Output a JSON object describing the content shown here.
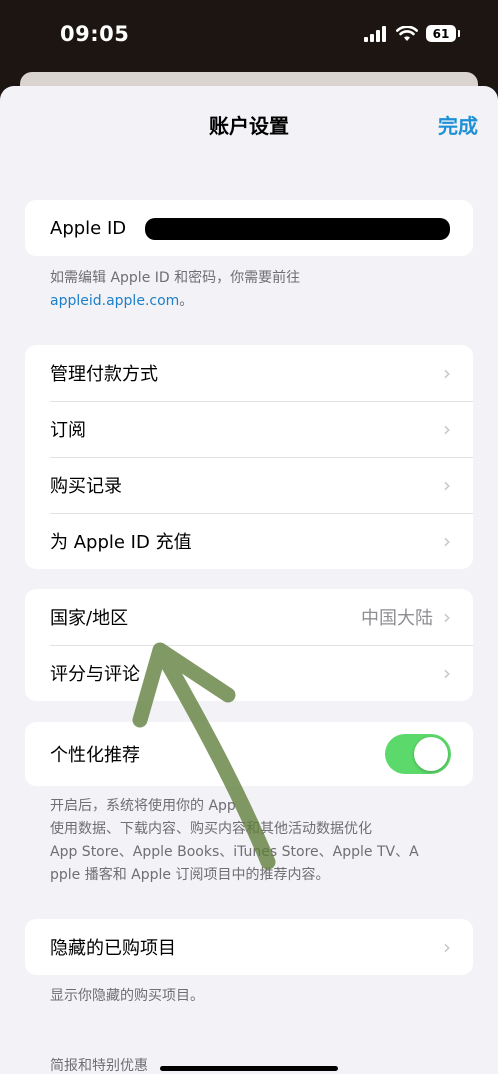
{
  "status_bar": {
    "time": "09:05",
    "battery": "61"
  },
  "nav": {
    "title": "账户设置",
    "done": "完成"
  },
  "apple_id": {
    "label": "Apple ID",
    "note_text": "如需编辑 Apple ID 和密码，你需要前往",
    "note_link": "appleid.apple.com",
    "note_tail": "。"
  },
  "group_payment": [
    {
      "label": "管理付款方式"
    },
    {
      "label": "订阅"
    },
    {
      "label": "购买记录"
    },
    {
      "label": "为 Apple ID 充值"
    }
  ],
  "group_region": {
    "country_label": "国家/地区",
    "country_value": "中国大陆",
    "ratings_label": "评分与评论"
  },
  "personalization": {
    "label": "个性化推荐",
    "enabled": true,
    "note_lines": [
      "开启后，系统将使用你的 App",
      "使用数据、下载内容、购买内容和其他活动数据优化",
      "App Store、Apple Books、iTunes Store、Apple TV、A",
      "pple 播客和 Apple 订阅项目中的推荐内容。"
    ]
  },
  "hidden_purchases": {
    "label": "隐藏的已购项目",
    "note": "显示你隐藏的购买项目。"
  },
  "newsletter_header": "简报和特别优惠",
  "colors": {
    "accent": "#1e90d6",
    "toggle_on": "#5bd96a",
    "annotation": "#5e7d3a"
  }
}
